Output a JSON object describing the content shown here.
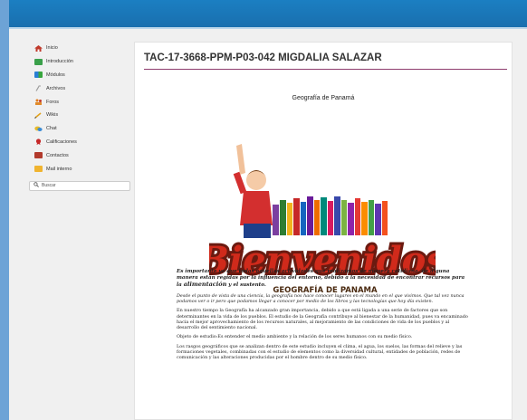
{
  "sidebar": {
    "items": [
      {
        "label": "Inicio",
        "icon": "home-icon"
      },
      {
        "label": "Introducción",
        "icon": "intro-icon"
      },
      {
        "label": "Módulos",
        "icon": "modules-icon"
      },
      {
        "label": "Archivos",
        "icon": "files-icon"
      },
      {
        "label": "Foros",
        "icon": "forums-icon"
      },
      {
        "label": "Wikis",
        "icon": "wiki-icon"
      },
      {
        "label": "Chat",
        "icon": "chat-icon"
      },
      {
        "label": "Calificaciones",
        "icon": "grades-icon"
      },
      {
        "label": "Contactos",
        "icon": "contacts-icon"
      },
      {
        "label": "Mail interno",
        "icon": "mail-icon"
      }
    ],
    "search_label": "Buscar"
  },
  "main": {
    "title": "TAC-17-3668-PPM-P03-042 MIGDALIA SALAZAR",
    "section_heading": "Geografía de Panamá",
    "banner": {
      "word": "Bienvenidos",
      "subtitle": "GEOGRAFÍA DE PANAMA"
    },
    "intro": {
      "before": "Es importante ya que todas aquellas actividades que realizamos de manera cotidiana, de alguna manera están regidas por la influencia del entorno, debido a la necesidad de encontrar recursos para la ",
      "highlight": "alimentación",
      "after": " y el sustento."
    },
    "paragraphs": [
      "Desde el punto de vista de una ciencia, la geografía nos hace conocer lugares en el mundo en el que vivimos. Que tal vez nunca podamos ver o ir pero que podamos llegar a conocer por medio de los libros y las tecnologías que hoy día existen.",
      "En nuestro tiempo la Geografía ha alcanzado gran importancia, debido a que está ligada a una serie de factores que son determinantes en la vida de los pueblos. El estudio de la Geografía contribuye al bienestar de la humanidad, pues va encaminado hacia el mejor aprovechamiento de los recursos naturales, al mejoramiento de las condiciones de vida de los pueblos y al desarrollo del sentimiento nacional.",
      "Objeto de estudio:Es entender el medio ambiente y la relación de los seres humanos con su medio físico.",
      "Los rasgos geográficos que se analizan dentro de este estudio incluyen el clima, el agua, los suelos, las formas del relieve y las formaciones vegetales, combinadas con el estudio de elementos como la diversidad cultural, entidades de población, redes de comunicación y las alteraciones producidas por el hombre dentro de su medio físico."
    ]
  },
  "colors": {
    "topbar": "#1a78bd",
    "title_rule": "#8e3d6e",
    "banner_red": "#d02a1b"
  }
}
